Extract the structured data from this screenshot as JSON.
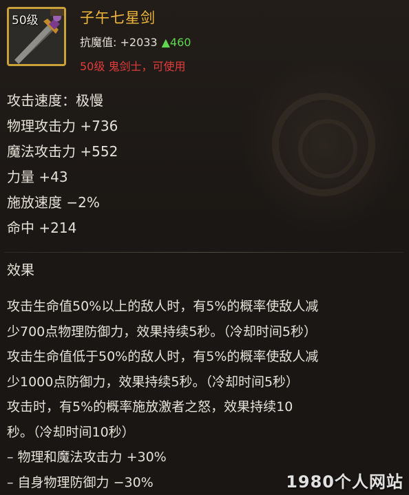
{
  "item": {
    "level_badge": "50级",
    "name": "子午七星剑",
    "resist_label": "抗魔值: +2033",
    "resist_increase": "▲460",
    "requirement": "50级 鬼剑士，可使用"
  },
  "stats": [
    "攻击速度：极慢",
    "物理攻击力 +736",
    "魔法攻击力 +552",
    "力量 +43",
    "施放速度 −2%",
    "命中 +214"
  ],
  "effect": {
    "title": "效果",
    "lines": [
      "攻击生命值50%以上的敌人时，有5%的概率使敌人减",
      "少700点物理防御力，效果持续5秒。（冷却时间5秒）",
      "攻击生命值低于50%的敌人时，有5%的概率使敌人减",
      "少1000点防御力，效果持续5秒。（冷却时间5秒）",
      "攻击时，有5%的概率施放激者之怒，效果持续10",
      "秒。（冷却时间10秒）",
      " – 物理和魔法攻击力 +30%",
      " – 自身物理防御力 −30%"
    ]
  },
  "watermark": "1980个人网站",
  "colors": {
    "item_name": "#f1b73a",
    "resist_increase": "#5fd64f",
    "requirement": "#e43c3c",
    "icon_border": "#c9a23a"
  },
  "icons": {
    "item": "sword-icon"
  }
}
